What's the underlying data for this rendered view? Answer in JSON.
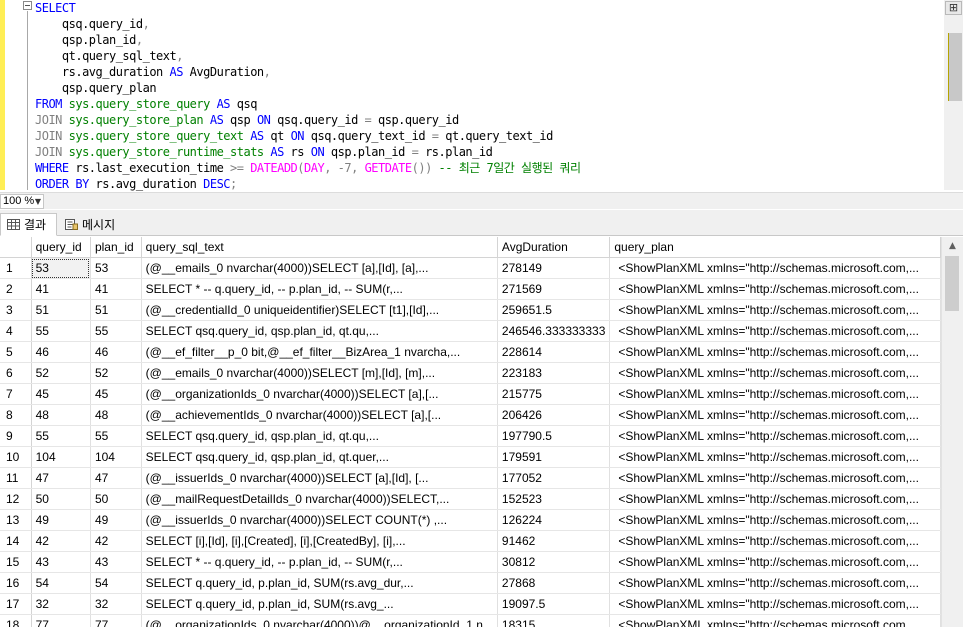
{
  "editor": {
    "lines": [
      [
        {
          "t": "SELECT",
          "c": "kw"
        }
      ],
      [
        {
          "t": "    qsq.query_id",
          "c": ""
        },
        {
          "t": ",",
          "c": "gr"
        }
      ],
      [
        {
          "t": "    qsp.plan_id",
          "c": ""
        },
        {
          "t": ",",
          "c": "gr"
        }
      ],
      [
        {
          "t": "    qt.query_sql_text",
          "c": ""
        },
        {
          "t": ",",
          "c": "gr"
        }
      ],
      [
        {
          "t": "    rs.avg_duration ",
          "c": ""
        },
        {
          "t": "AS",
          "c": "kw"
        },
        {
          "t": " AvgDuration",
          "c": ""
        },
        {
          "t": ",",
          "c": "gr"
        }
      ],
      [
        {
          "t": "    qsp.query_plan",
          "c": ""
        }
      ],
      [
        {
          "t": "FROM ",
          "c": "kw"
        },
        {
          "t": "sys.query_store_query",
          "c": "tb"
        },
        {
          "t": " ",
          "c": ""
        },
        {
          "t": "AS",
          "c": "kw"
        },
        {
          "t": " qsq",
          "c": ""
        }
      ],
      [
        {
          "t": "JOIN ",
          "c": "gr"
        },
        {
          "t": "sys.query_store_plan",
          "c": "tb"
        },
        {
          "t": " ",
          "c": ""
        },
        {
          "t": "AS",
          "c": "kw"
        },
        {
          "t": " qsp ",
          "c": ""
        },
        {
          "t": "ON",
          "c": "kw"
        },
        {
          "t": " qsq.query_id ",
          "c": ""
        },
        {
          "t": "=",
          "c": "gr"
        },
        {
          "t": " qsp.query_id",
          "c": ""
        }
      ],
      [
        {
          "t": "JOIN ",
          "c": "gr"
        },
        {
          "t": "sys.query_store_query_text",
          "c": "tb"
        },
        {
          "t": " ",
          "c": ""
        },
        {
          "t": "AS",
          "c": "kw"
        },
        {
          "t": " qt ",
          "c": ""
        },
        {
          "t": "ON",
          "c": "kw"
        },
        {
          "t": " qsq.query_text_id ",
          "c": ""
        },
        {
          "t": "=",
          "c": "gr"
        },
        {
          "t": " qt.query_text_id",
          "c": ""
        }
      ],
      [
        {
          "t": "JOIN ",
          "c": "gr"
        },
        {
          "t": "sys.query_store_runtime_stats",
          "c": "tb"
        },
        {
          "t": " ",
          "c": ""
        },
        {
          "t": "AS",
          "c": "kw"
        },
        {
          "t": " rs ",
          "c": ""
        },
        {
          "t": "ON",
          "c": "kw"
        },
        {
          "t": " qsp.plan_id ",
          "c": ""
        },
        {
          "t": "=",
          "c": "gr"
        },
        {
          "t": " rs.plan_id",
          "c": ""
        }
      ],
      [
        {
          "t": "WHERE",
          "c": "kw"
        },
        {
          "t": " rs.last_execution_time ",
          "c": ""
        },
        {
          "t": ">=",
          "c": "gr"
        },
        {
          "t": " ",
          "c": ""
        },
        {
          "t": "DATEADD",
          "c": "fn"
        },
        {
          "t": "(",
          "c": "gr"
        },
        {
          "t": "DAY",
          "c": "fn"
        },
        {
          "t": ", ",
          "c": "gr"
        },
        {
          "t": "-7",
          "c": "gr"
        },
        {
          "t": ", ",
          "c": "gr"
        },
        {
          "t": "GETDATE",
          "c": "fn"
        },
        {
          "t": "()) ",
          "c": "gr"
        },
        {
          "t": "-- 최근 7일간 실행된 쿼리",
          "c": "cm"
        }
      ],
      [
        {
          "t": "ORDER BY",
          "c": "kw"
        },
        {
          "t": " rs.avg_duration ",
          "c": ""
        },
        {
          "t": "DESC",
          "c": "kw"
        },
        {
          "t": ";",
          "c": "gr"
        }
      ]
    ],
    "split_icon": "split-arrows-icon"
  },
  "zoom": {
    "value": "100 %"
  },
  "tabs": [
    {
      "label": "결과",
      "icon": "grid-icon"
    },
    {
      "label": "메시지",
      "icon": "messages-icon"
    }
  ],
  "grid": {
    "columns": [
      "query_id",
      "plan_id",
      "query_sql_text",
      "AvgDuration",
      "query_plan"
    ],
    "rows": [
      [
        "1",
        "53",
        "53",
        "(@__emails_0 nvarchar(4000))SELECT [a],[Id], [a],...",
        "278149",
        "<ShowPlanXML xmlns=\"http://schemas.microsoft.com,..."
      ],
      [
        "2",
        "41",
        "41",
        "SELECT * -- q.query_id, -- p.plan_id, -- SUM(r,...",
        "271569",
        "<ShowPlanXML xmlns=\"http://schemas.microsoft.com,..."
      ],
      [
        "3",
        "51",
        "51",
        "(@__credentialId_0 uniqueidentifier)SELECT [t1],[Id],...",
        "259651.5",
        "<ShowPlanXML xmlns=\"http://schemas.microsoft.com,..."
      ],
      [
        "4",
        "55",
        "55",
        "SELECT    qsq.query_id,    qsp.plan_id,    qt.qu,...",
        "246546.333333333",
        "<ShowPlanXML xmlns=\"http://schemas.microsoft.com,..."
      ],
      [
        "5",
        "46",
        "46",
        "(@__ef_filter__p_0 bit,@__ef_filter__BizArea_1 nvarcha,...",
        "228614",
        "<ShowPlanXML xmlns=\"http://schemas.microsoft.com,..."
      ],
      [
        "6",
        "52",
        "52",
        "(@__emails_0 nvarchar(4000))SELECT [m],[Id], [m],...",
        "223183",
        "<ShowPlanXML xmlns=\"http://schemas.microsoft.com,..."
      ],
      [
        "7",
        "45",
        "45",
        "(@__organizationIds_0 nvarchar(4000))SELECT [a],[...",
        "215775",
        "<ShowPlanXML xmlns=\"http://schemas.microsoft.com,..."
      ],
      [
        "8",
        "48",
        "48",
        "(@__achievementIds_0 nvarchar(4000))SELECT [a],[...",
        "206426",
        "<ShowPlanXML xmlns=\"http://schemas.microsoft.com,..."
      ],
      [
        "9",
        "55",
        "55",
        "SELECT    qsq.query_id,    qsp.plan_id,    qt.qu,...",
        "197790.5",
        "<ShowPlanXML xmlns=\"http://schemas.microsoft.com,..."
      ],
      [
        "10",
        "104",
        "104",
        "SELECT    qsq.query_id,    qsp.plan_id,    qt.quer,...",
        "179591",
        "<ShowPlanXML xmlns=\"http://schemas.microsoft.com,..."
      ],
      [
        "11",
        "47",
        "47",
        "(@__issuerIds_0 nvarchar(4000))SELECT [a],[Id], [...",
        "177052",
        "<ShowPlanXML xmlns=\"http://schemas.microsoft.com,..."
      ],
      [
        "12",
        "50",
        "50",
        "(@__mailRequestDetailIds_0 nvarchar(4000))SELECT,...",
        "152523",
        "<ShowPlanXML xmlns=\"http://schemas.microsoft.com,..."
      ],
      [
        "13",
        "49",
        "49",
        "(@__issuerIds_0 nvarchar(4000))SELECT COUNT(*) ,...",
        "126224",
        "<ShowPlanXML xmlns=\"http://schemas.microsoft.com,..."
      ],
      [
        "14",
        "42",
        "42",
        "SELECT [i],[Id], [i],[Created], [i],[CreatedBy], [i],...",
        "91462",
        "<ShowPlanXML xmlns=\"http://schemas.microsoft.com,..."
      ],
      [
        "15",
        "43",
        "43",
        "SELECT * -- q.query_id, -- p.plan_id, -- SUM(r,...",
        "30812",
        "<ShowPlanXML xmlns=\"http://schemas.microsoft.com,..."
      ],
      [
        "16",
        "54",
        "54",
        "SELECT   q.query_id,   p.plan_id,   SUM(rs.avg_dur,...",
        "27868",
        "<ShowPlanXML xmlns=\"http://schemas.microsoft.com,..."
      ],
      [
        "17",
        "32",
        "32",
        "SELECT    q.query_id,    p.plan_id,    SUM(rs.avg_...",
        "19097.5",
        "<ShowPlanXML xmlns=\"http://schemas.microsoft.com,..."
      ],
      [
        "18",
        "77",
        "77",
        "(@__organizationIds_0 nvarchar(4000))@__organizationId_1 n...",
        "18315",
        "<ShowPlanXML xmlns=\"http://schemas.microsoft.com,..."
      ]
    ],
    "selected_cell": {
      "row": 0,
      "col": 1
    }
  }
}
